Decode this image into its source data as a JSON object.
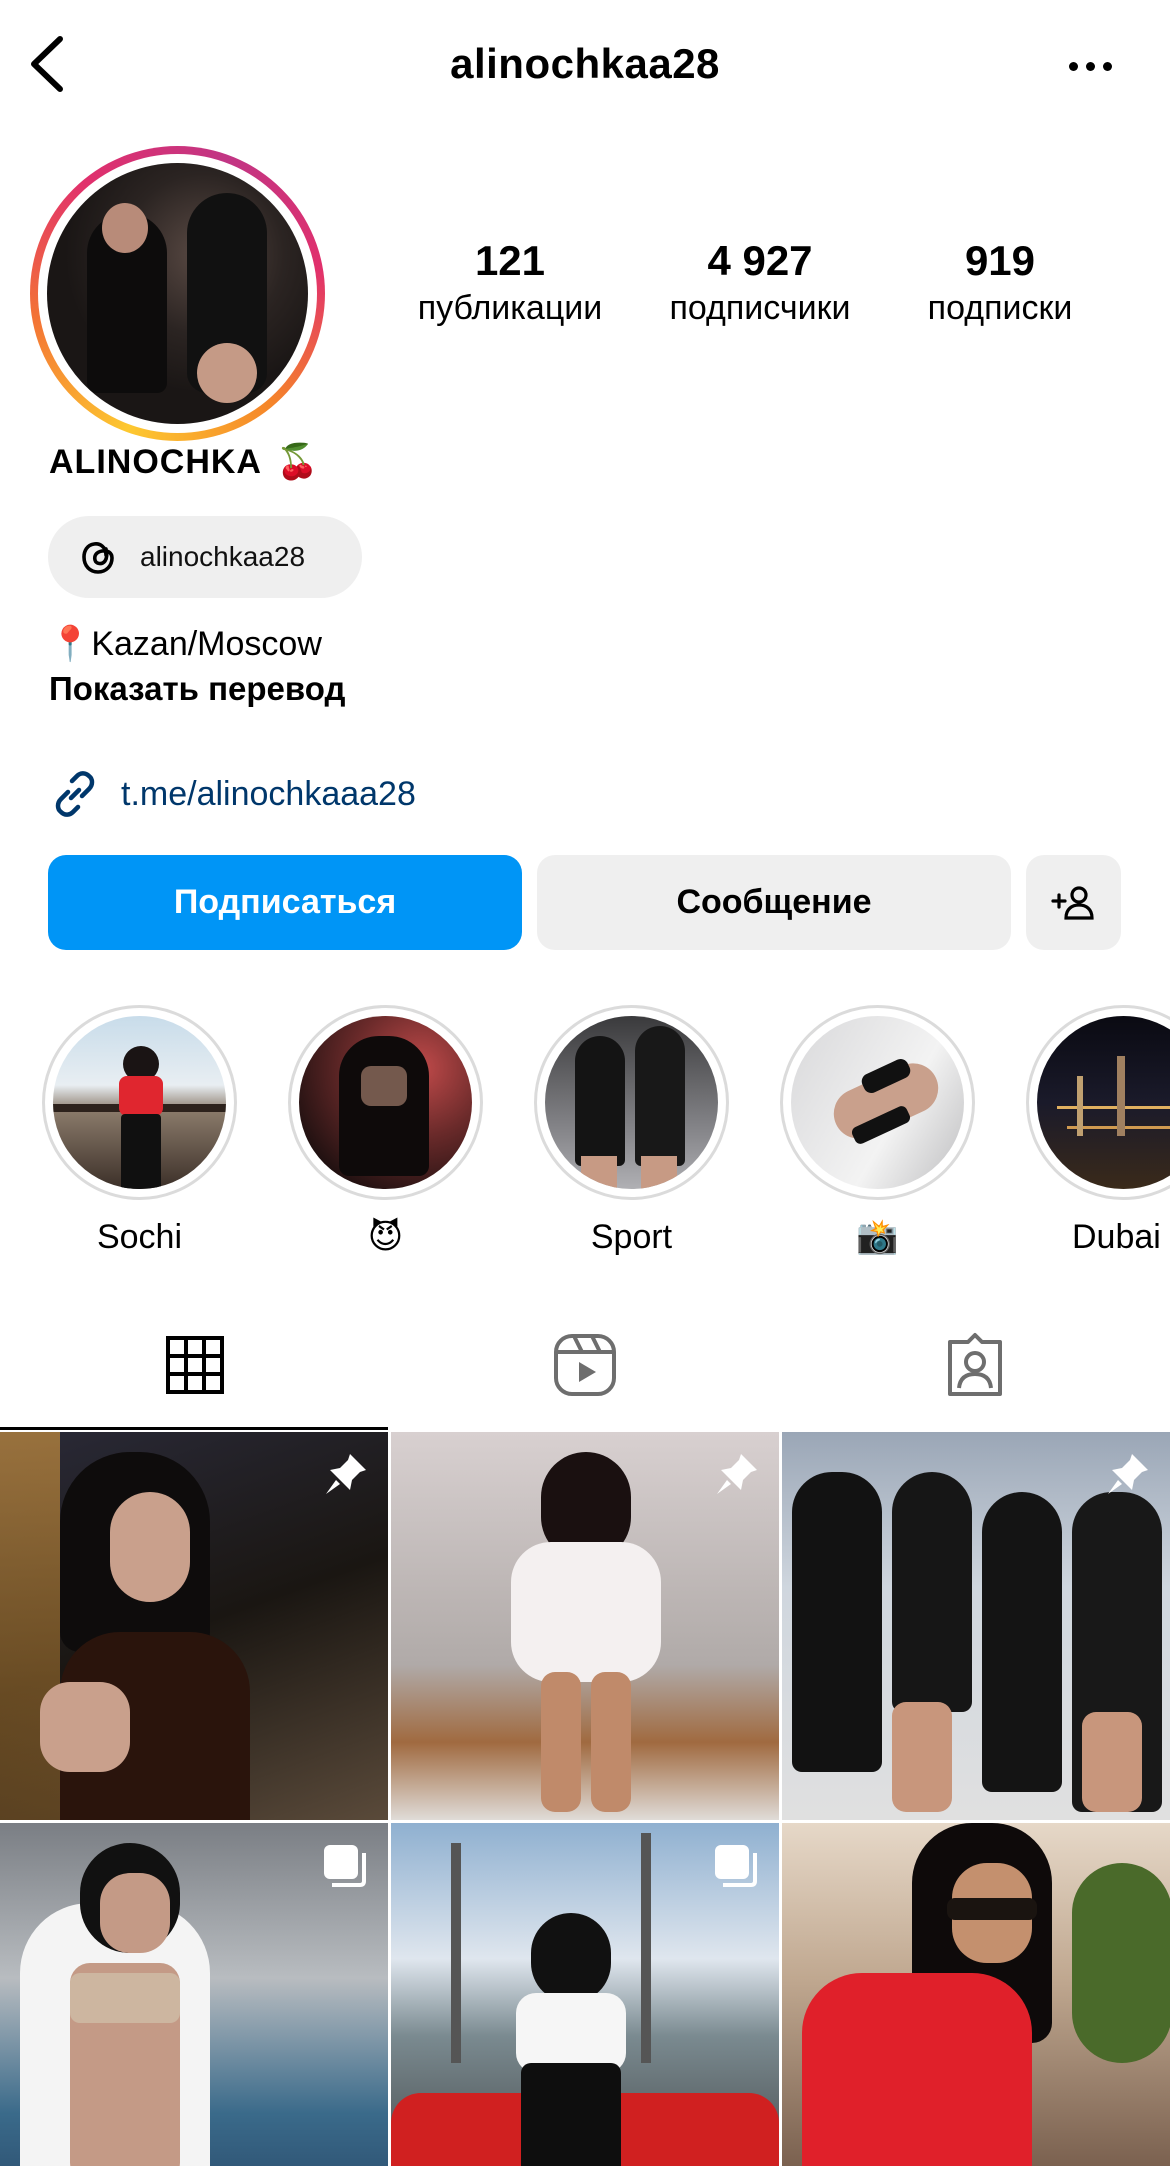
{
  "header": {
    "username": "alinochkaa28"
  },
  "profile": {
    "display_name": "ALINOCHKA",
    "name_emoji": "🍒",
    "stats": [
      {
        "value": "121",
        "label": "публикации"
      },
      {
        "value": "4 927",
        "label": "подписчики"
      },
      {
        "value": "919",
        "label": "подписки"
      }
    ],
    "threads_handle": "alinochkaa28",
    "bio_location": "📍Kazan/Moscow",
    "translate_label": "Показать перевод",
    "link": "t.me/alinochkaaa28"
  },
  "actions": {
    "follow_label": "Подписаться",
    "message_label": "Сообщение"
  },
  "highlights": [
    {
      "label": "Sochi"
    },
    {
      "label": "😈"
    },
    {
      "label": "Sport"
    },
    {
      "label": "📸"
    },
    {
      "label": "Dubai"
    }
  ],
  "tabs": [
    {
      "icon": "grid-icon"
    },
    {
      "icon": "reels-icon"
    },
    {
      "icon": "tagged-icon"
    }
  ],
  "posts": [
    {
      "badge": "pin-icon"
    },
    {
      "badge": "pin-icon"
    },
    {
      "badge": "pin-icon"
    },
    {
      "badge": "carousel-icon"
    },
    {
      "badge": "carousel-icon"
    },
    {
      "badge": "none"
    }
  ],
  "colors": {
    "follow_button": "#0095f6",
    "secondary_button": "#efefef",
    "link_text": "#00376b"
  }
}
